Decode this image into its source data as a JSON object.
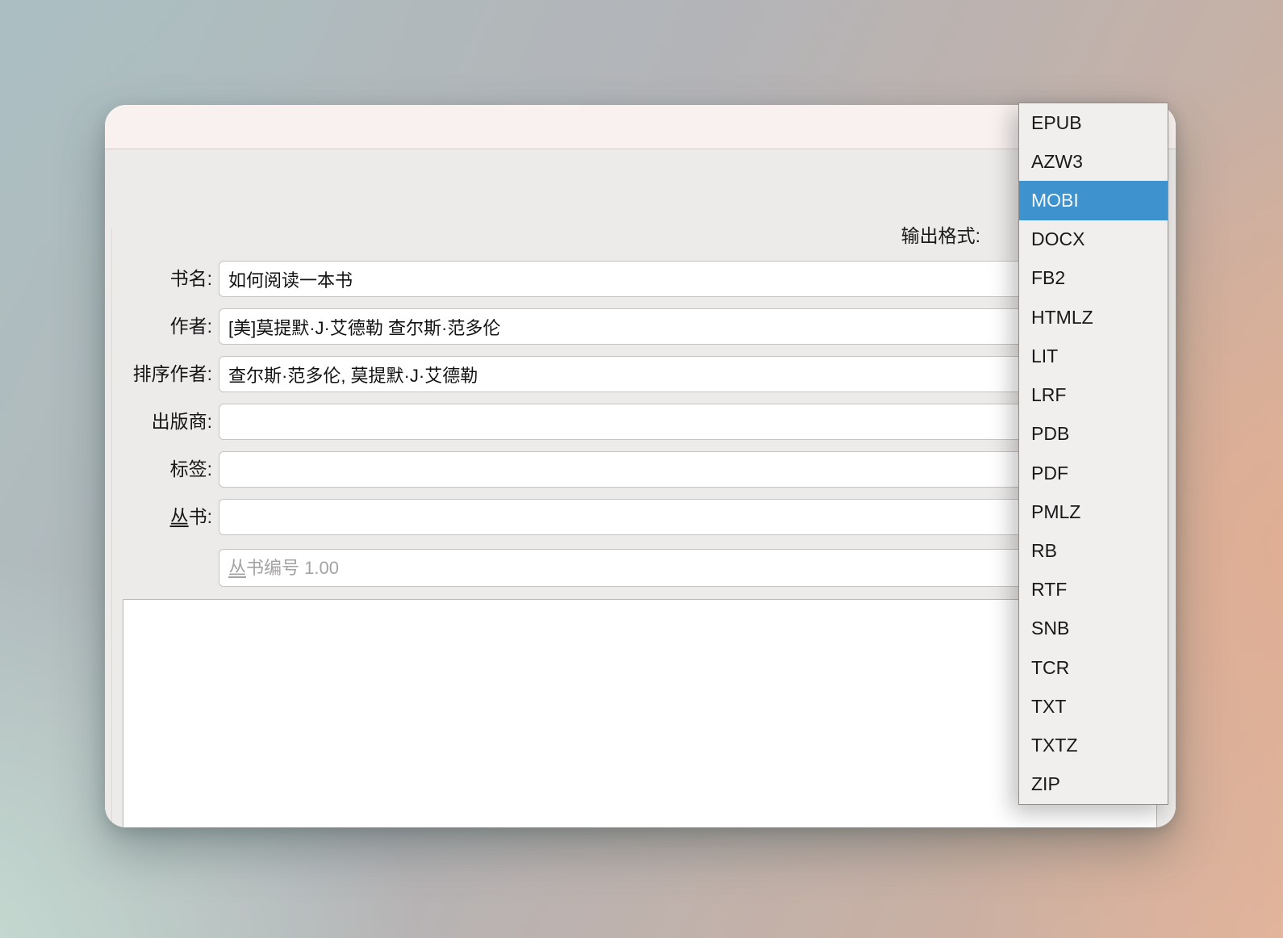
{
  "window": {
    "title": "",
    "output_format": {
      "label": "输出格式:"
    },
    "fields": [
      {
        "id": "book-title",
        "label": "书名:",
        "value": "如何阅读一本书"
      },
      {
        "id": "authors",
        "label": "作者:",
        "value": "[美]莫提默·J·艾德勒 查尔斯·范多伦"
      },
      {
        "id": "author-sort",
        "label": "排序作者:",
        "value": "查尔斯·范多伦, 莫提默·J·艾德勒"
      },
      {
        "id": "publisher",
        "label": "出版商:",
        "value": ""
      },
      {
        "id": "tags",
        "label": "标签:",
        "value": ""
      },
      {
        "id": "series",
        "label": "丛书:",
        "value": "",
        "underline_first_char": true
      }
    ],
    "series_index": {
      "placeholder": "丛书编号 1.00",
      "underline_first_char": true,
      "value": ""
    },
    "comments": {
      "value": ""
    }
  },
  "format_dropdown": {
    "items": [
      "EPUB",
      "AZW3",
      "MOBI",
      "DOCX",
      "FB2",
      "HTMLZ",
      "LIT",
      "LRF",
      "PDB",
      "PDF",
      "PMLZ",
      "RB",
      "RTF",
      "SNB",
      "TCR",
      "TXT",
      "TXTZ",
      "ZIP"
    ],
    "selected": "MOBI"
  },
  "colors": {
    "selection_blue": "#3E93CE",
    "titlebar_bg": "#F8F1F0",
    "form_bg": "#EDEBE9",
    "dropdown_bg": "#F1EFEE"
  },
  "layout_values": {
    "row_tops": [
      137,
      196,
      255,
      314,
      373,
      432
    ]
  }
}
